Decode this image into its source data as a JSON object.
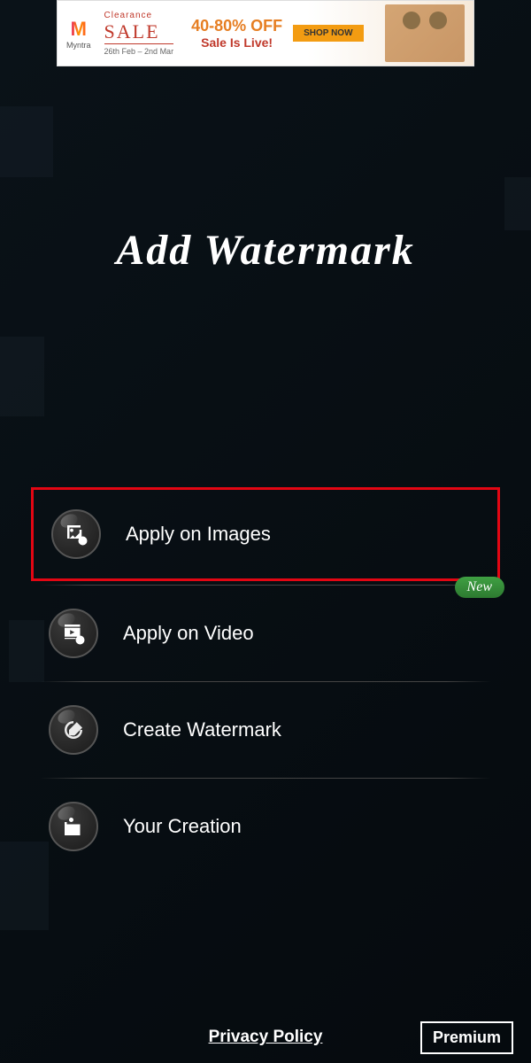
{
  "ad": {
    "brand": "Myntra",
    "clearance": "Clearance",
    "sale": "SALE",
    "dates": "26th Feb – 2nd Mar",
    "discount": "40-80% OFF",
    "live": "Sale Is Live!",
    "cta": "SHOP NOW"
  },
  "app": {
    "title": "Add Watermark"
  },
  "menu": {
    "items": [
      {
        "label": "Apply on Images",
        "icon": "images-check-icon",
        "highlighted": true,
        "badge": null
      },
      {
        "label": "Apply on Video",
        "icon": "video-check-icon",
        "highlighted": false,
        "badge": "New"
      },
      {
        "label": "Create Watermark",
        "icon": "watermark-pencil-icon",
        "highlighted": false,
        "badge": null
      },
      {
        "label": "Your Creation",
        "icon": "gallery-icon",
        "highlighted": false,
        "badge": null
      }
    ]
  },
  "footer": {
    "privacy": "Privacy Policy",
    "premium": "Premium"
  }
}
